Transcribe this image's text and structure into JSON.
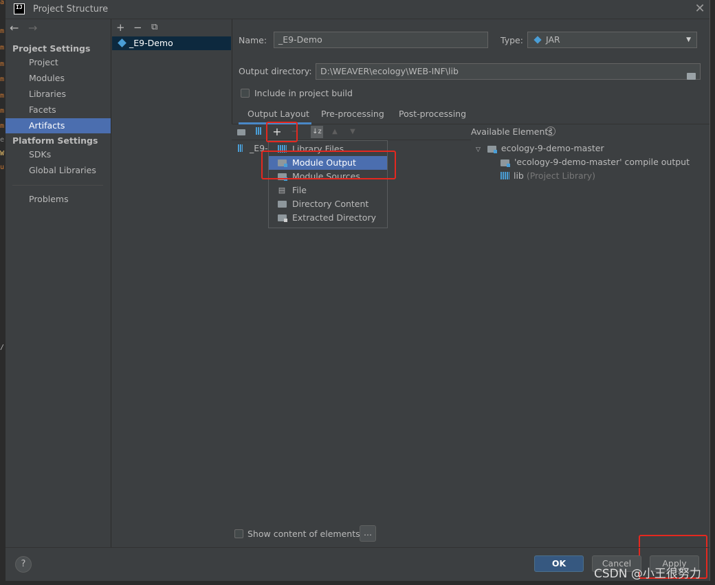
{
  "window": {
    "title": "Project Structure",
    "logo": "IJ"
  },
  "nav": {
    "back": "←",
    "forward": "→",
    "project_settings_header": "Project Settings",
    "items": [
      "Project",
      "Modules",
      "Libraries",
      "Facets",
      "Artifacts"
    ],
    "platform_settings_header": "Platform Settings",
    "platform_items": [
      "SDKs",
      "Global Libraries"
    ],
    "problems": "Problems",
    "selected": "Artifacts"
  },
  "artifacts_list": {
    "toolbar": {
      "add": "+",
      "remove": "−",
      "copy": "⧉"
    },
    "items": [
      "_E9-Demo"
    ]
  },
  "form": {
    "name_label": "Name:",
    "name_value": "_E9-Demo",
    "type_label": "Type:",
    "type_value": "JAR",
    "output_dir_label": "Output directory:",
    "output_dir_value": "D:\\WEAVER\\ecology\\WEB-INF\\lib",
    "include_in_build_label": "Include in project build",
    "include_in_build_checked": false
  },
  "tabs": [
    "Output Layout",
    "Pre-processing",
    "Post-processing"
  ],
  "active_tab": "Output Layout",
  "layout": {
    "root_item": "_E9-I",
    "add_menu": [
      {
        "label": "Library Files",
        "icon": "library-icon"
      },
      {
        "label": "Module Output",
        "icon": "module-folder-icon",
        "selected": true
      },
      {
        "label": "Module Sources",
        "icon": "module-folder-icon"
      },
      {
        "label": "File",
        "icon": "file-icon"
      },
      {
        "label": "Directory Content",
        "icon": "folder-icon"
      },
      {
        "label": "Extracted Directory",
        "icon": "extracted-folder-icon"
      }
    ]
  },
  "available": {
    "header": "Available Elements",
    "help": "?",
    "module": "ecology-9-demo-master",
    "children": [
      {
        "label": "'ecology-9-demo-master' compile output",
        "suffix": ""
      },
      {
        "label": "lib",
        "suffix": "(Project Library)"
      }
    ]
  },
  "show_content_label": "Show content of elements",
  "show_content_checked": false,
  "more_button": "...",
  "buttons": {
    "help": "?",
    "ok": "OK",
    "cancel": "Cancel",
    "apply": "Apply"
  },
  "watermark": "CSDN @小王很努力",
  "colors": {
    "accent": "#4b6eaf",
    "highlight_box": "#e5281f",
    "ok_button": "#365880"
  }
}
